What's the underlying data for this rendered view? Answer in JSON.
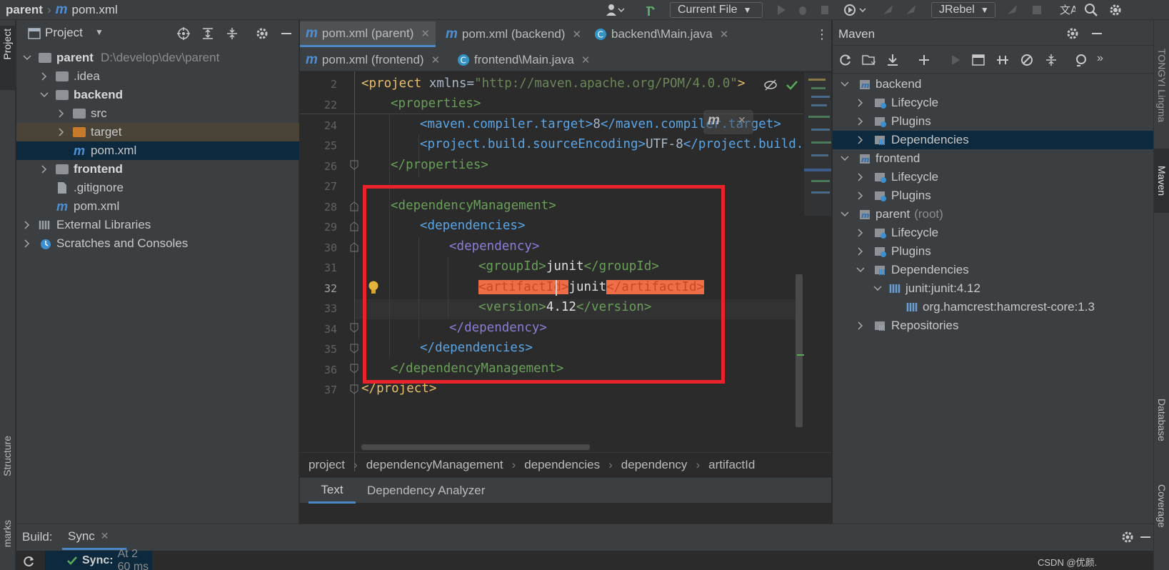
{
  "breadcrumb": {
    "root": "parent",
    "file": "pom.xml"
  },
  "toolbar": {
    "run_config": "Current File",
    "jrebel": "JRebel"
  },
  "left_strip": {
    "project": "Project",
    "structure": "Structure",
    "bookmarks": "marks"
  },
  "right_strip": {
    "tongyi": "TONGYI Lingma",
    "maven": "Maven",
    "database": "Database",
    "coverage": "Coverage"
  },
  "project_panel": {
    "title": "Project",
    "tree": [
      {
        "label": "parent",
        "extra": "D:\\develop\\dev\\parent",
        "bold": true
      },
      {
        "label": ".idea"
      },
      {
        "label": "backend",
        "bold": true
      },
      {
        "label": "src"
      },
      {
        "label": "target"
      },
      {
        "label": "pom.xml"
      },
      {
        "label": "frontend",
        "bold": true
      },
      {
        "label": ".gitignore"
      },
      {
        "label": "pom.xml"
      },
      {
        "label": "External Libraries"
      },
      {
        "label": "Scratches and Consoles"
      }
    ]
  },
  "editor": {
    "tabs_row1": [
      {
        "label": "pom.xml (parent)"
      },
      {
        "label": "pom.xml (backend)"
      },
      {
        "label": "backend\\Main.java"
      }
    ],
    "tabs_row2": [
      {
        "label": "pom.xml (frontend)"
      },
      {
        "label": "frontend\\Main.java"
      }
    ],
    "line_numbers": [
      "2",
      "22",
      "24",
      "25",
      "26",
      "27",
      "28",
      "29",
      "30",
      "31",
      "32",
      "33",
      "34",
      "35",
      "36",
      "37"
    ],
    "lines": {
      "l2_open": "<project",
      "l2_attr": " xmlns=",
      "l2_val": "\"http://maven.apache.org/POM/4.0.0\"",
      "l2_close": ">",
      "l22": "<properties>",
      "l24_open": "<maven.compiler.target>",
      "l24_val": "8",
      "l24_close": "</maven.compiler.target>",
      "l25_open": "<project.build.sourceEncoding>",
      "l25_val": "UTF-8",
      "l25_close": "</project.build.s",
      "l26": "</properties>",
      "l28": "<dependencyManagement>",
      "l29": "<dependencies>",
      "l30": "<dependency>",
      "l31_open": "<groupId>",
      "l31_val": "junit",
      "l31_close": "</groupId>",
      "l32_open": "<artifactId>",
      "l32_val": "junit",
      "l32_close": "</artifactId>",
      "l33_open": "<version>",
      "l33_val": "4.12",
      "l33_close": "</version>",
      "l34": "</dependency>",
      "l35": "</dependencies>",
      "l36": "</dependencyManagement>",
      "l37": "</project>"
    },
    "breadcrumbs": [
      "project",
      "dependencyManagement",
      "dependencies",
      "dependency",
      "artifactId"
    ],
    "bottom_tabs": [
      "Text",
      "Dependency Analyzer"
    ],
    "highlight_color": "#e8232b"
  },
  "maven_panel": {
    "title": "Maven",
    "tree": [
      {
        "label": "backend"
      },
      {
        "label": "Lifecycle"
      },
      {
        "label": "Plugins"
      },
      {
        "label": "Dependencies"
      },
      {
        "label": "frontend"
      },
      {
        "label": "Lifecycle"
      },
      {
        "label": "Plugins"
      },
      {
        "label": "parent",
        "extra": "(root)"
      },
      {
        "label": "Lifecycle"
      },
      {
        "label": "Plugins"
      },
      {
        "label": "Dependencies"
      },
      {
        "label": "junit:junit:4.12"
      },
      {
        "label": "org.hamcrest:hamcrest-core:1.3"
      },
      {
        "label": "Repositories"
      }
    ]
  },
  "build_panel": {
    "label": "Build:",
    "tab": "Sync",
    "status": "Sync:",
    "status_detail": "At 2 60 ms",
    "watermark": "CSDN @优颜."
  }
}
